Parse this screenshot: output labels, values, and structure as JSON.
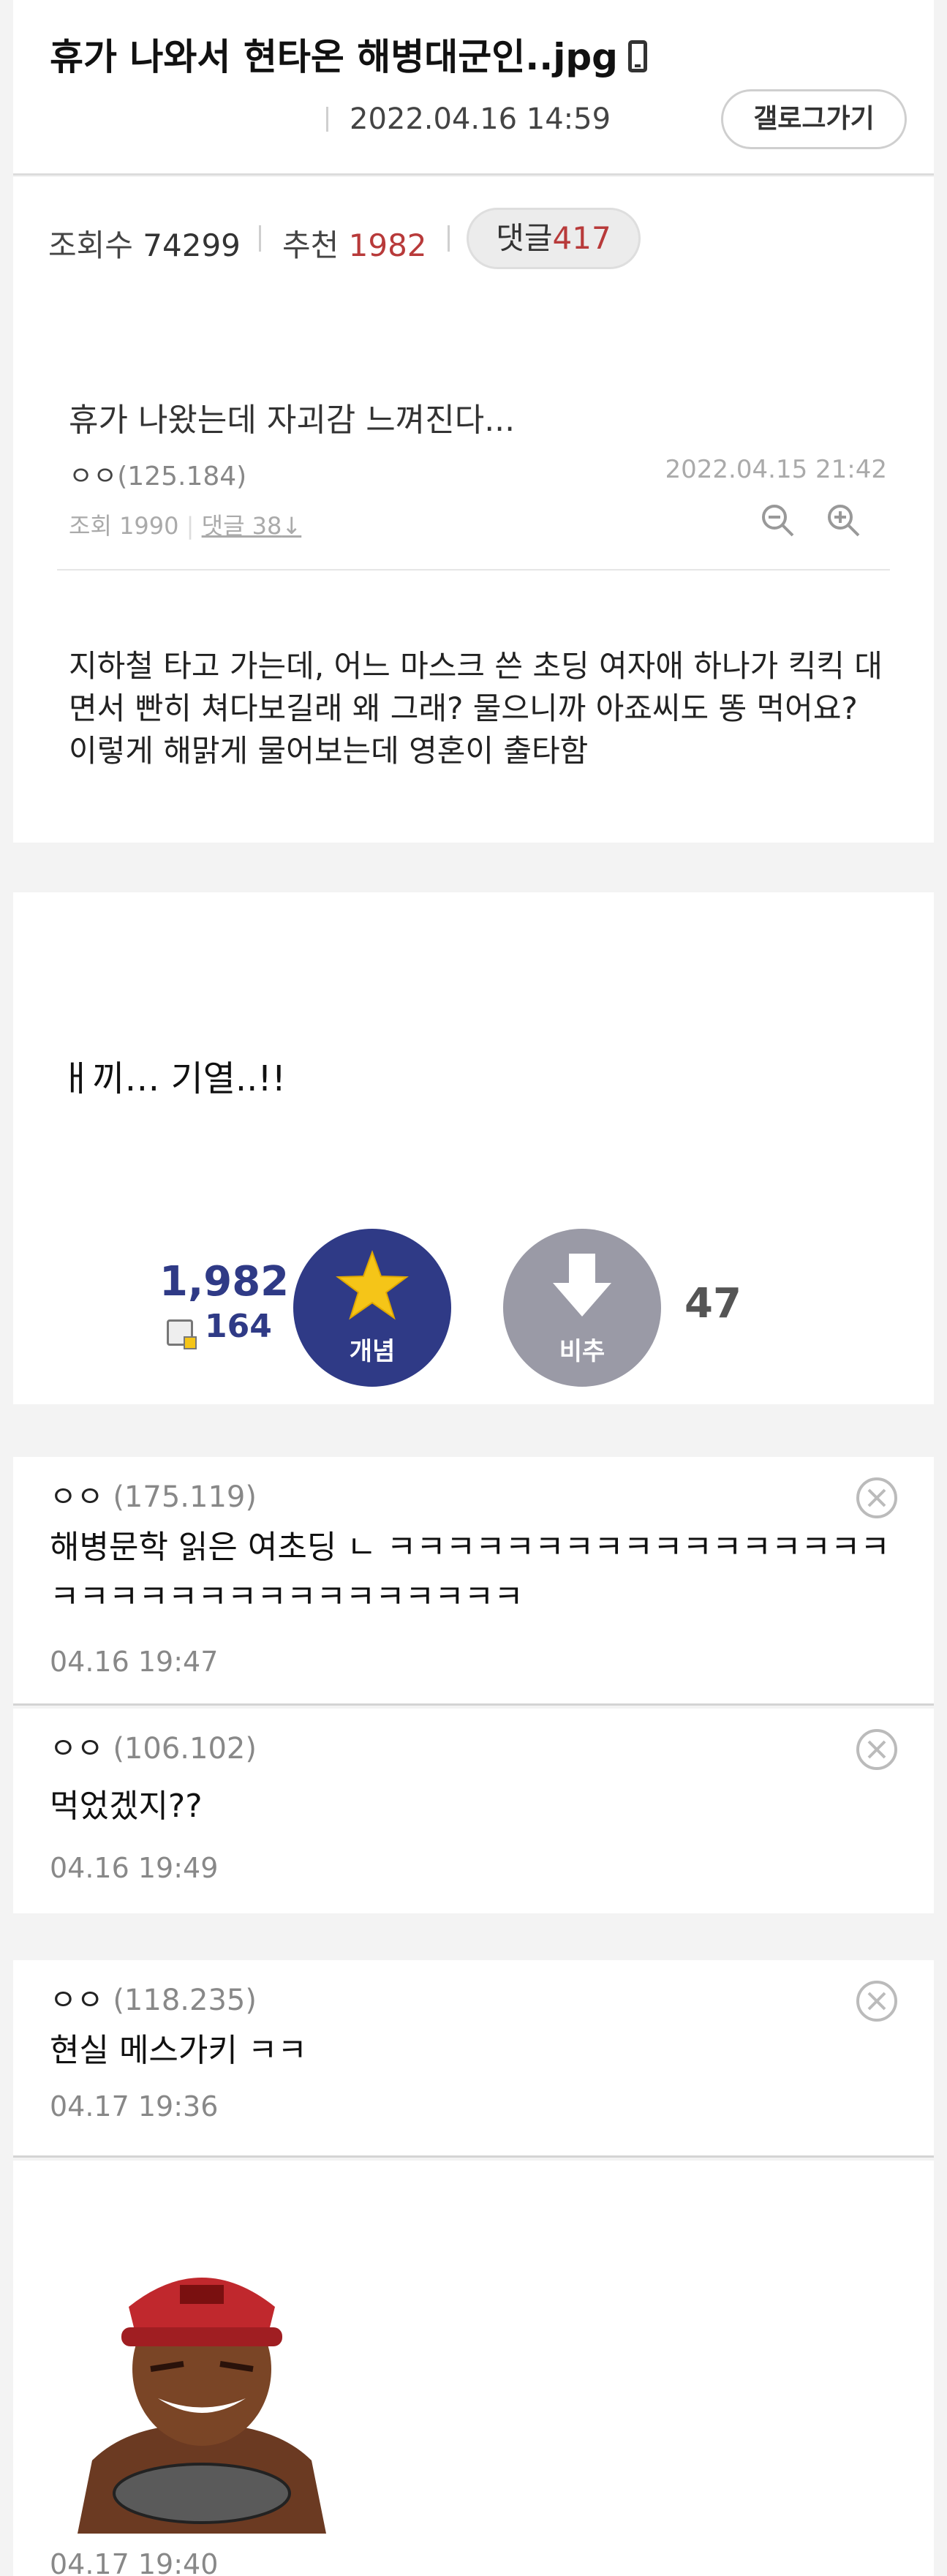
{
  "header": {
    "title": "휴가 나와서 현타온 해병대군인..jpg",
    "date": "2022.04.16 14:59",
    "gallog_button": "갤로그가기"
  },
  "stats": {
    "views_label": "조회수",
    "views": "74299",
    "recommend_label": "추천",
    "recommend": "1982",
    "reply_label": "댓글",
    "reply": "417"
  },
  "post": {
    "title": "휴가 나왔는데 자괴감 느껴진다...",
    "author": "ㅇㅇ",
    "ip": "(125.184)",
    "date": "2022.04.15 21:42",
    "views_label": "조회",
    "views": "1990",
    "replies": "댓글 38",
    "body": "지하철 타고 가는데, 어느 마스크 쓴 초딩 여자애 하나가 킥킥 대면서 빤히 쳐다보길래 왜 그래? 물으니까 아죠씨도 똥 먹어요? 이렇게 해맑게 물어보는데 영혼이 출타함"
  },
  "content": {
    "meme_text": "ㅐ끼… 기열..!!",
    "upvotes": "1,982",
    "fixed_upvotes": "164",
    "upvote_label": "개념",
    "downvote_label": "비추",
    "downvotes": "47"
  },
  "comments": [
    {
      "author": "ㅇㅇ",
      "ip": "(175.119)",
      "text": "해병문학 읽은 여초딩 ㄴ ㅋㅋㅋㅋㅋㅋㅋㅋㅋㅋㅋㅋㅋㅋㅋㅋㅋㅋㅋㅋㅋㅋㅋㅋㅋㅋㅋㅋㅋㅋㅋㅋㅋ",
      "date": "04.16 19:47"
    },
    {
      "author": "ㅇㅇ",
      "ip": "(106.102)",
      "text": "먹었겠지??",
      "date": "04.16 19:49"
    },
    {
      "author": "ㅇㅇ",
      "ip": "(118.235)",
      "text": "현실 메스가키 ㅋㅋ",
      "date": "04.17 19:36"
    },
    {
      "date": "04.17 19:40"
    }
  ],
  "colors": {
    "accent_navy": "#2f3a86",
    "accent_red": "#b83a3a",
    "downvote_gray": "#9a9aa6"
  }
}
